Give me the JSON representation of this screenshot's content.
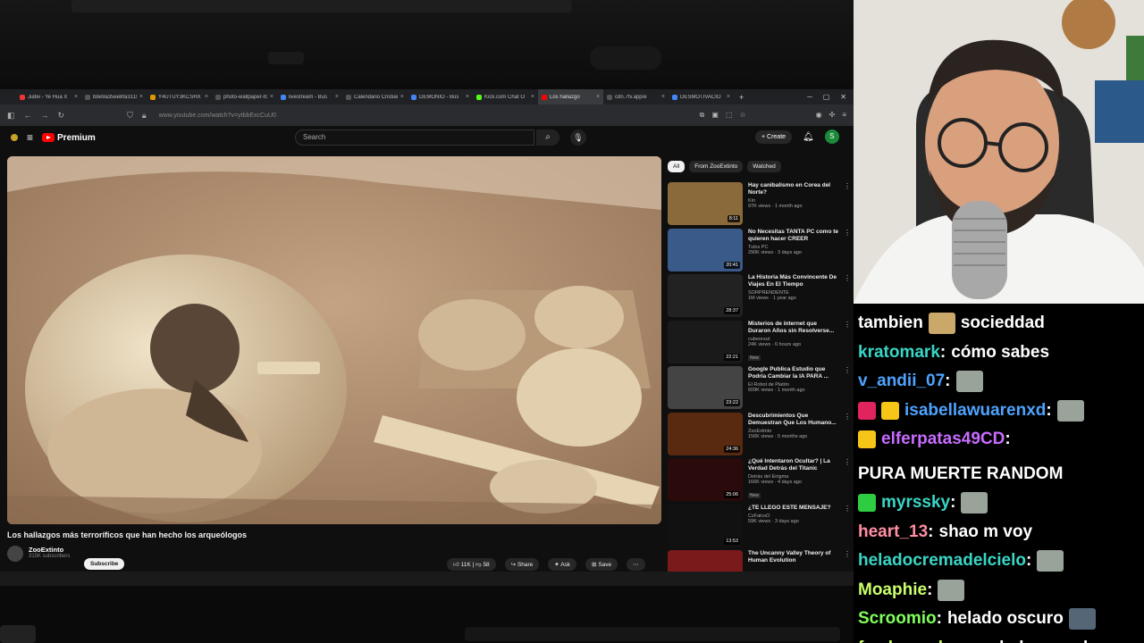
{
  "browser": {
    "tabs": [
      {
        "label": "Jiafei - Ye Hua X",
        "fav": "#e33",
        "active": false
      },
      {
        "label": "b8e9a35ee8fa3118",
        "fav": "#555",
        "active": false
      },
      {
        "label": "Y4UTUY3KCSHX",
        "fav": "#d90",
        "active": false
      },
      {
        "label": "photo-wallpaper-for",
        "fav": "#555",
        "active": false
      },
      {
        "label": "livestream - Bus",
        "fav": "#4285f4",
        "active": false
      },
      {
        "label": "Calendario Cristiano",
        "fav": "#555",
        "active": false
      },
      {
        "label": "DEMONIO - Bus",
        "fav": "#4285f4",
        "active": false
      },
      {
        "label": "Kick.com Chat O",
        "fav": "#53fc18",
        "active": false
      },
      {
        "label": "Los hallazgo",
        "fav": "#f00",
        "active": true
      },
      {
        "label": "cdn.7tv.app/e",
        "fav": "#555",
        "active": false
      },
      {
        "label": "DESMOTIVACIO",
        "fav": "#4285f4",
        "active": false
      }
    ],
    "url": "www.youtube.com/watch?v=ytbbExcCuU0"
  },
  "youtube": {
    "logo": "Premium",
    "search_placeholder": "Search",
    "create_label": "+ Create",
    "avatar_letter": "S",
    "video": {
      "title": "Los hallazgos más terroríficos que han hecho los arqueólogos",
      "channel": "ZooExtinto",
      "subscribers": "315K subscribers",
      "subscribe_label": "Subscribe",
      "likes": "11K",
      "dislikes": "58",
      "share_label": "Share",
      "ask_label": "Ask",
      "save_label": "Save"
    },
    "chips": [
      "All",
      "From ZooExtinto",
      "Watched"
    ],
    "recommendations": [
      {
        "title": "Hay canibalismo en Corea del Norte?",
        "channel": "Kin",
        "meta": "97K views · 1 month ago",
        "duration": "8:11",
        "color": "#8a6a3a",
        "new": ""
      },
      {
        "title": "No Necesitas TANTA PC como te quieren hacer CREER",
        "channel": "Tulos PC",
        "meta": "290K views · 3 days ago",
        "duration": "20:41",
        "color": "#3a5a8a",
        "new": ""
      },
      {
        "title": "La Historia Más Convincente De Viajes En El Tiempo",
        "channel": "SORPRENDENTE",
        "meta": "1M views · 1 year ago",
        "duration": "28:37",
        "color": "#222",
        "new": ""
      },
      {
        "title": "Misterios de internet que Duraron Años sin Resolverse...",
        "channel": "cubeorsut",
        "meta": "24K views · 6 hours ago",
        "duration": "22:21",
        "color": "#1a1a1a",
        "new": "New"
      },
      {
        "title": "Google Publica Estudio que Podría Cambiar la IA PARA ...",
        "channel": "El Robot de Platón",
        "meta": "609K views · 1 month ago",
        "duration": "23:22",
        "color": "#444",
        "new": ""
      },
      {
        "title": "Descubrimientos Que Demuestran Que Los Humano...",
        "channel": "ZooExtinto",
        "meta": "156K views · 5 months ago",
        "duration": "24:36",
        "color": "#5a2a10",
        "new": ""
      },
      {
        "title": "¿Qué Intentaron Ocultar? | La Verdad Detrás del Titanic",
        "channel": "Detrás del Enigma",
        "meta": "166K views · 4 days ago",
        "duration": "25:06",
        "color": "#2a0a0a",
        "new": "New"
      },
      {
        "title": "¿TE LLEGÓ ESTE MENSAJE?",
        "channel": "CzFalcoO",
        "meta": "59K views · 3 days ago",
        "duration": "13:53",
        "color": "#111",
        "new": ""
      },
      {
        "title": "The Uncanny Valley Theory of Human Evolution",
        "channel": "",
        "meta": "",
        "duration": "",
        "color": "#7a1a1a",
        "new": ""
      }
    ]
  },
  "chat": [
    {
      "user": "",
      "user_color": "#fff",
      "pre": "tambien",
      "text": "socieddad",
      "emote": "#c9a86a",
      "after_emote": true
    },
    {
      "user": "kratomark",
      "user_color": "#39d6c6",
      "text": "cómo sabes"
    },
    {
      "user": "v_andii_07",
      "user_color": "#4da3ff",
      "text": "",
      "emote": "#9aa39a"
    },
    {
      "user": "isabellawuarenxd",
      "user_color": "#4da3ff",
      "text": "",
      "emote": "#9aa39a",
      "badges": [
        "#e0245e",
        "#f5c518"
      ]
    },
    {
      "user": "elferpatas49CD",
      "user_color": "#c86cff",
      "text": "PURA MUERTE RANDOM",
      "badges": [
        "#f5c518"
      ]
    },
    {
      "user": "myrssky",
      "user_color": "#39d6c6",
      "text": "",
      "emote": "#9aa39a",
      "badges": [
        "#2ecc40"
      ]
    },
    {
      "user": "heart_13",
      "user_color": "#ff8fa3",
      "text": "shao m voy"
    },
    {
      "user": "heladocremadelcielo",
      "user_color": "#39d6c6",
      "text": "",
      "emote": "#9aa39a"
    },
    {
      "user": "Moaphie",
      "user_color": "#c8ff6a",
      "text": "",
      "emote": "#9aa39a"
    },
    {
      "user": "Scroomio",
      "user_color": "#7fff5a",
      "text": "helado oscuro",
      "emote": "#556677"
    },
    {
      "user": "femboypeke",
      "user_color": "#c8ff6a",
      "text": "verdad que voh"
    }
  ]
}
